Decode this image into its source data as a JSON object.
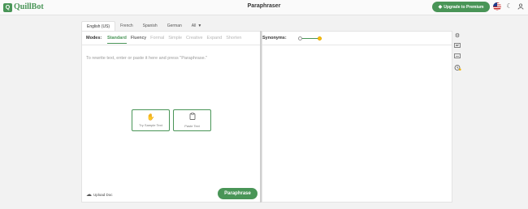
{
  "header": {
    "logo_mark": "Q",
    "logo_text": "QuillBot",
    "title": "Paraphraser",
    "premium_label": "Upgrade to Premium",
    "premium_icon": "diamond-icon",
    "flag_icon": "us-flag-icon",
    "theme_icon": "moon-icon",
    "account_icon": "user-icon"
  },
  "languages": {
    "tabs": [
      "English (US)",
      "French",
      "Spanish",
      "German",
      "All"
    ],
    "active": "English (US)"
  },
  "modes": {
    "label": "Modes:",
    "items": [
      "Standard",
      "Fluency",
      "Formal",
      "Simple",
      "Creative",
      "Expand",
      "Shorten"
    ],
    "active": "Standard"
  },
  "synonyms": {
    "label": "Synonyms:"
  },
  "editor": {
    "placeholder": "To rewrite text, enter or paste it here and press \"Paraphrase.\"",
    "sample_label": "Try Sample Text",
    "paste_label": "Paste Text",
    "upload_label": "Upload Doc",
    "paraphrase_label": "Paraphrase"
  },
  "sidebar_tools": [
    "settings-icon",
    "feedback-icon",
    "keyboard-icon",
    "history-icon"
  ],
  "colors": {
    "accent": "#499557",
    "background": "#f2f2f2"
  }
}
